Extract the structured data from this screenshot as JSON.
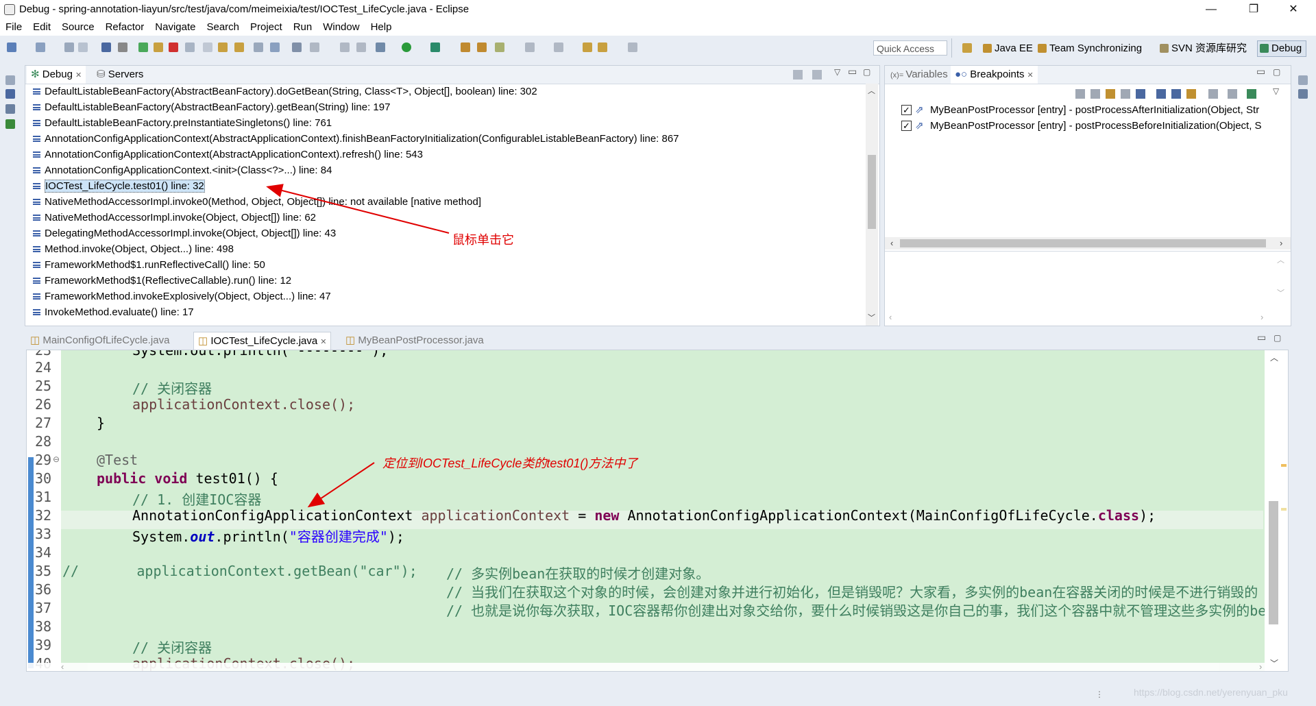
{
  "window": {
    "title": "Debug - spring-annotation-liayun/src/test/java/com/meimeixia/test/IOCTest_LifeCycle.java - Eclipse",
    "controls": [
      "—",
      "❐",
      "✕"
    ]
  },
  "menu": [
    "File",
    "Edit",
    "Source",
    "Refactor",
    "Navigate",
    "Search",
    "Project",
    "Run",
    "Window",
    "Help"
  ],
  "toolbar": {
    "quick_access": "Quick Access",
    "perspectives": [
      "Java EE",
      "Team Synchronizing",
      "SVN 资源库研究",
      "Debug"
    ]
  },
  "debug_panel": {
    "tabs": [
      "Debug",
      "Servers"
    ],
    "frames": [
      "DefaultListableBeanFactory(AbstractBeanFactory).doGetBean(String, Class<T>, Object[], boolean) line: 302",
      "DefaultListableBeanFactory(AbstractBeanFactory).getBean(String) line: 197",
      "DefaultListableBeanFactory.preInstantiateSingletons() line: 761",
      "AnnotationConfigApplicationContext(AbstractApplicationContext).finishBeanFactoryInitialization(ConfigurableListableBeanFactory) line: 867",
      "AnnotationConfigApplicationContext(AbstractApplicationContext).refresh() line: 543",
      "AnnotationConfigApplicationContext.<init>(Class<?>...) line: 84",
      "IOCTest_LifeCycle.test01() line: 32",
      "NativeMethodAccessorImpl.invoke0(Method, Object, Object[]) line: not available [native method]",
      "NativeMethodAccessorImpl.invoke(Object, Object[]) line: 62",
      "DelegatingMethodAccessorImpl.invoke(Object, Object[]) line: 43",
      "Method.invoke(Object, Object...) line: 498",
      "FrameworkMethod$1.runReflectiveCall() line: 50",
      "FrameworkMethod$1(ReflectiveCallable).run() line: 12",
      "FrameworkMethod.invokeExplosively(Object, Object...) line: 47",
      "InvokeMethod.evaluate() line: 17"
    ],
    "selected_index": 6
  },
  "breakpoints_panel": {
    "tabs": [
      "Variables",
      "Breakpoints"
    ],
    "items": [
      "MyBeanPostProcessor [entry] - postProcessAfterInitialization(Object, Str",
      "MyBeanPostProcessor [entry] - postProcessBeforeInitialization(Object, S"
    ]
  },
  "editor": {
    "tabs": [
      "MainConfigOfLifeCycle.java",
      "IOCTest_LifeCycle.java",
      "MyBeanPostProcessor.java"
    ],
    "active_tab": 1,
    "line_numbers": [
      "23",
      "24",
      "25",
      "26",
      "27",
      "28",
      "29",
      "30",
      "31",
      "32",
      "33",
      "34",
      "35",
      "36",
      "37",
      "38",
      "39",
      "40"
    ],
    "code": {
      "l23": "System.out.println(\"--------\");",
      "l25": "// 关闭容器",
      "l26": "applicationContext.close();",
      "l27": "}",
      "l29": "@Test",
      "l30_kw": "public void",
      "l30_rest": " test01() {",
      "l31": "// 1. 创建IOC容器",
      "l32_type": "AnnotationConfigApplicationContext",
      "l32_var": "applicationContext",
      "l32_eq": " = ",
      "l32_new": "new",
      "l32_call": " AnnotationConfigApplicationContext(MainConfigOfLifeCycle.",
      "l32_class": "class",
      "l32_end": ");",
      "l33_a": "System.",
      "l33_out": "out",
      "l33_b": ".println(",
      "l33_str": "\"容器创建完成\"",
      "l33_c": ");",
      "l35_code": "//       applicationContext.getBean(\"car\");",
      "l35_cm": "// 多实例bean在获取的时候才创建对象。",
      "l36_cm": "// 当我们在获取这个对象的时候，会创建对象并进行初始化，但是销毁呢？大家看，多实例的bean在容器关闭的时候是不进行销毁的",
      "l37_cm": "// 也就是说你每次获取，IOC容器帮你创建出对象交给你，要什么时候销毁这是你自己的事，我们这个容器中就不管理这些多实例的bean了",
      "l39": "// 关闭容器",
      "l40": "applicationContext.close();"
    }
  },
  "annotations": {
    "click_it": "鼠标单击它",
    "located": "定位到IOCTest_LifeCycle类的test01()方法中了"
  },
  "watermark": "https://blog.csdn.net/yerenyuan_pku",
  "colors": {
    "arrow": "#e00000",
    "code_bg": "#d4eed4",
    "current_line": "#e6f3e6",
    "selection": "#cde4f7"
  }
}
